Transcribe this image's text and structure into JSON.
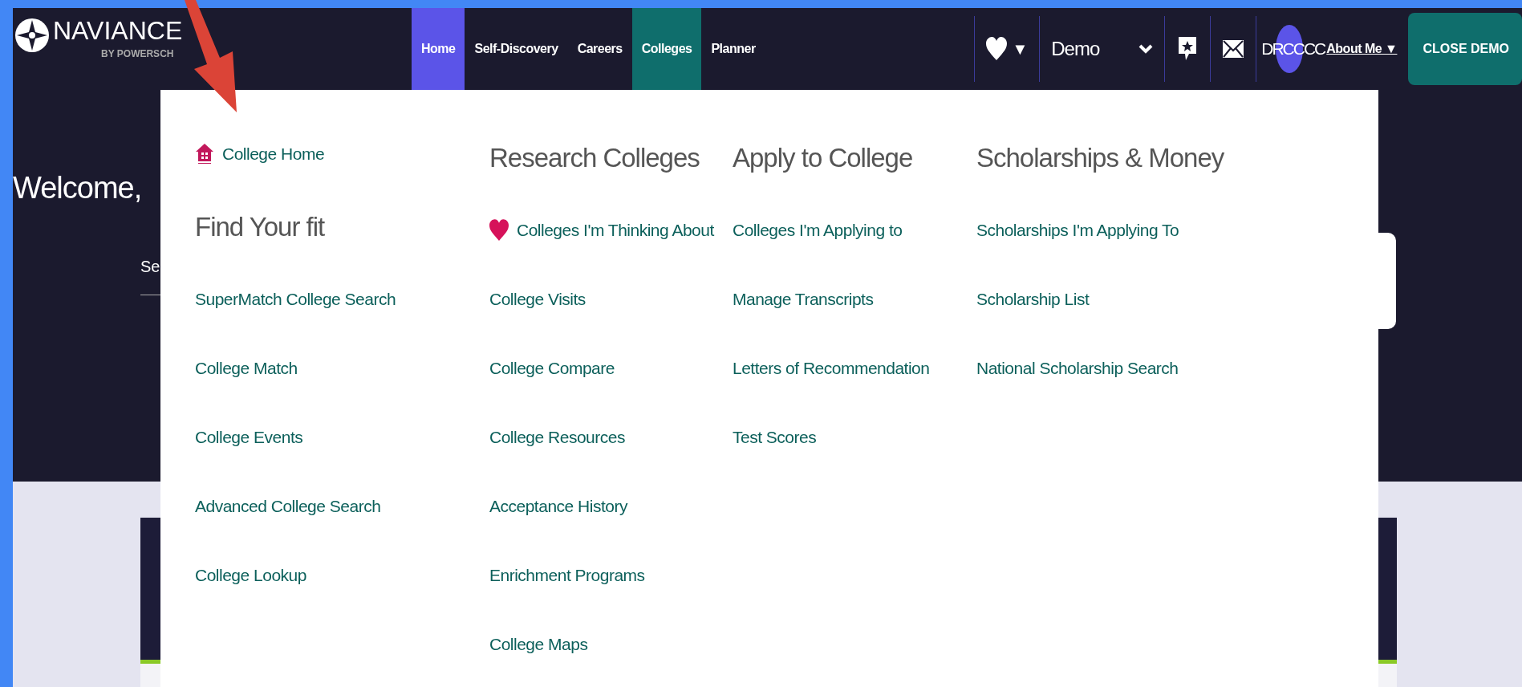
{
  "logo": {
    "name": "NAVIANCE",
    "tagline": "BY POWERSCH"
  },
  "nav": [
    {
      "label": "Home",
      "selected": true,
      "open": false
    },
    {
      "label": "Self-Discovery",
      "selected": false,
      "open": false
    },
    {
      "label": "Careers",
      "selected": false,
      "open": false
    },
    {
      "label": "Colleges",
      "selected": false,
      "open": true
    },
    {
      "label": "Planner",
      "selected": false,
      "open": false
    }
  ],
  "toolbar": {
    "favorites_caret": "▼",
    "demo_select": "Demo",
    "avatar": "DRCCCC",
    "about_me": "About Me ▼",
    "close_button": "CLOSE DEMO"
  },
  "hero": {
    "greeting": "Welcome,",
    "search_label": "Se"
  },
  "menu_columns": [
    {
      "items": [
        {
          "kind": "home-link",
          "text": "College Home"
        },
        {
          "kind": "heading",
          "text": "Find Your fit"
        },
        {
          "kind": "link",
          "text": "SuperMatch College Search"
        },
        {
          "kind": "link",
          "text": "College Match"
        },
        {
          "kind": "link",
          "text": "College Events"
        },
        {
          "kind": "link",
          "text": "Advanced College Search"
        },
        {
          "kind": "link",
          "text": "College Lookup"
        }
      ]
    },
    {
      "items": [
        {
          "kind": "heading",
          "text": "Research Colleges"
        },
        {
          "kind": "favorite-link",
          "text": "Colleges I'm Thinking About"
        },
        {
          "kind": "link",
          "text": "College Visits"
        },
        {
          "kind": "link",
          "text": "College Compare"
        },
        {
          "kind": "link",
          "text": "College Resources"
        },
        {
          "kind": "link",
          "text": "Acceptance History"
        },
        {
          "kind": "link",
          "text": "Enrichment Programs"
        },
        {
          "kind": "link",
          "text": "College Maps"
        }
      ]
    },
    {
      "items": [
        {
          "kind": "heading",
          "text": "Apply to College"
        },
        {
          "kind": "link",
          "text": "Colleges I'm Applying to"
        },
        {
          "kind": "link",
          "text": "Manage Transcripts"
        },
        {
          "kind": "link",
          "text": "Letters of Recommendation"
        },
        {
          "kind": "link",
          "text": "Test Scores"
        }
      ]
    },
    {
      "items": [
        {
          "kind": "heading",
          "text": "Scholarships & Money"
        },
        {
          "kind": "link",
          "text": "Scholarships I'm Applying To"
        },
        {
          "kind": "link",
          "text": "Scholarship List"
        },
        {
          "kind": "link",
          "text": "National Scholarship Search"
        }
      ]
    }
  ]
}
